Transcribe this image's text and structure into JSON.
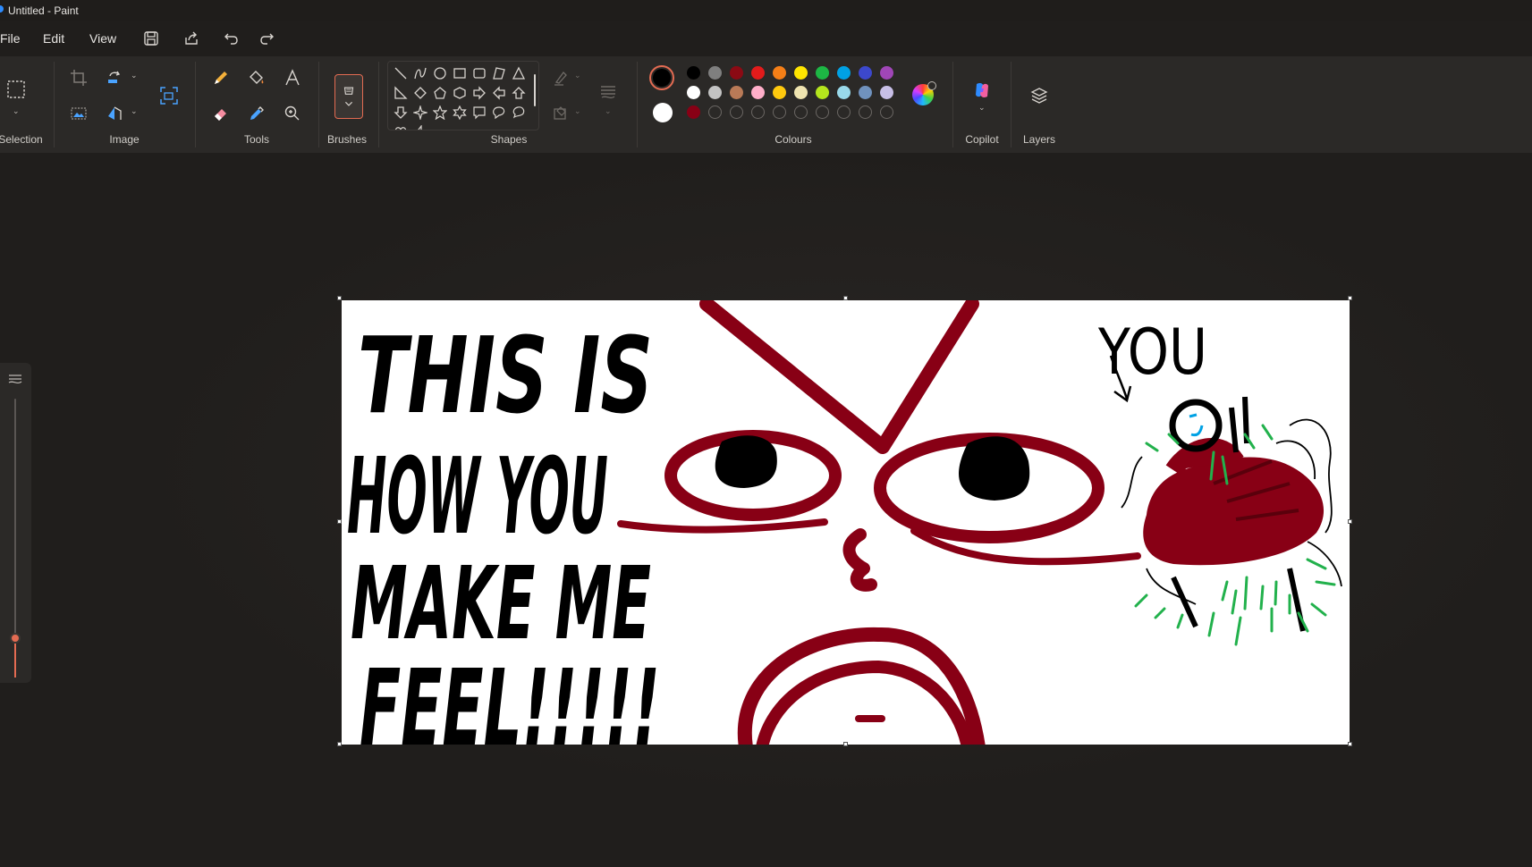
{
  "window": {
    "title": "Untitled - Paint"
  },
  "menu": {
    "file": "File",
    "edit": "Edit",
    "view": "View"
  },
  "ribbon": {
    "groups": {
      "selection": "Selection",
      "image": "Image",
      "tools": "Tools",
      "brushes": "Brushes",
      "shapes": "Shapes",
      "colours": "Colours",
      "copilot": "Copilot",
      "layers": "Layers"
    },
    "primary_color": "#000000",
    "secondary_color": "#ffffff",
    "palette_row1": [
      "#000000",
      "#7f7f7f",
      "#8b0a14",
      "#e21b1b",
      "#f57f17",
      "#ffe500",
      "#1db744",
      "#00a1e4",
      "#3c48cc",
      "#a046b7"
    ],
    "palette_row2": [
      "#ffffff",
      "#c3c3c3",
      "#b97a57",
      "#ffaec9",
      "#ffc90e",
      "#efe4b0",
      "#b5e61d",
      "#99d9ea",
      "#7092be",
      "#c8bfe7"
    ],
    "palette_row3": [
      "#880015"
    ]
  },
  "canvas": {
    "text_line1": "THIS IS",
    "text_line2": "HOW YOU",
    "text_line3": "MAKE ME",
    "text_line4": "FEEL!!!!!",
    "you_label": "YOU",
    "ink_color": "#000000",
    "face_color": "#880015",
    "splash_color": "#22b14c"
  },
  "slider": {
    "level": 0.86
  }
}
